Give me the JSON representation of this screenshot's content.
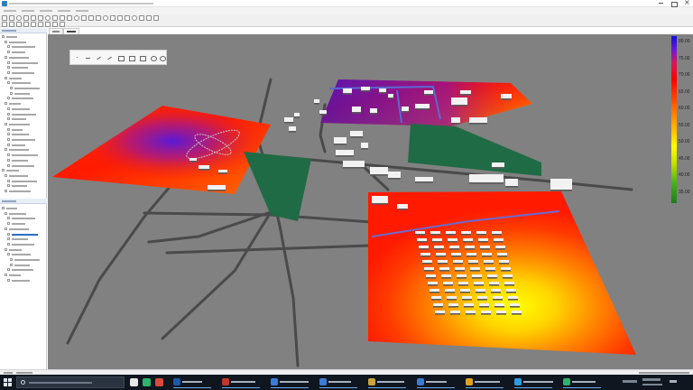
{
  "legend": {
    "title": "",
    "levels": [
      "80.00",
      "75.00",
      "70.00",
      "65.00",
      "60.00",
      "55.00",
      "50.00",
      "45.00",
      "40.00",
      "35.00"
    ]
  },
  "colors": {
    "viewport_bg": "#818181",
    "road": "#4a4a4a",
    "green_area": "#1f6b45",
    "building": "#f2f2f2",
    "accent": "#2c7fc2"
  },
  "icons": {
    "start": "windows-logo",
    "search": "magnifier",
    "taskbar_apps": [
      "terminal",
      "app",
      "app",
      "folder",
      "folder",
      "folder",
      "folder",
      "browser",
      "noise-app"
    ]
  }
}
